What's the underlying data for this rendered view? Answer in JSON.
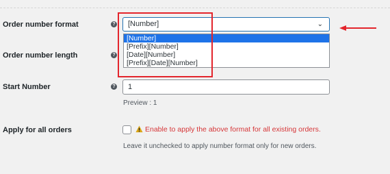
{
  "fields": {
    "order_number_format": {
      "label": "Order number format",
      "selected": "[Number]",
      "options": [
        "[Number]",
        "[Prefix][Number]",
        "[Date][Number]",
        "[Prefix][Date][Number]"
      ],
      "selected_index": 0
    },
    "order_number_length": {
      "label": "Order number length"
    },
    "start_number": {
      "label": "Start Number",
      "value": "1",
      "preview": "Preview : 1"
    },
    "apply_all_orders": {
      "label": "Apply for all orders",
      "checked": false,
      "warning": "Enable to apply the above format for all existing orders.",
      "description": "Leave it unchecked to apply number format only for new orders."
    }
  },
  "help_icon": "?",
  "colors": {
    "highlight_box": "#e3242b",
    "arrow": "#e3242b",
    "selected_option_bg": "#1e73e8",
    "warning_text": "#d63638",
    "focus_border": "#2271b1"
  },
  "icons": {
    "help": "question-circle-icon",
    "dropdown": "chevron-down-icon",
    "warning": "warning-triangle-icon",
    "pointer": "arrow-left-icon"
  }
}
